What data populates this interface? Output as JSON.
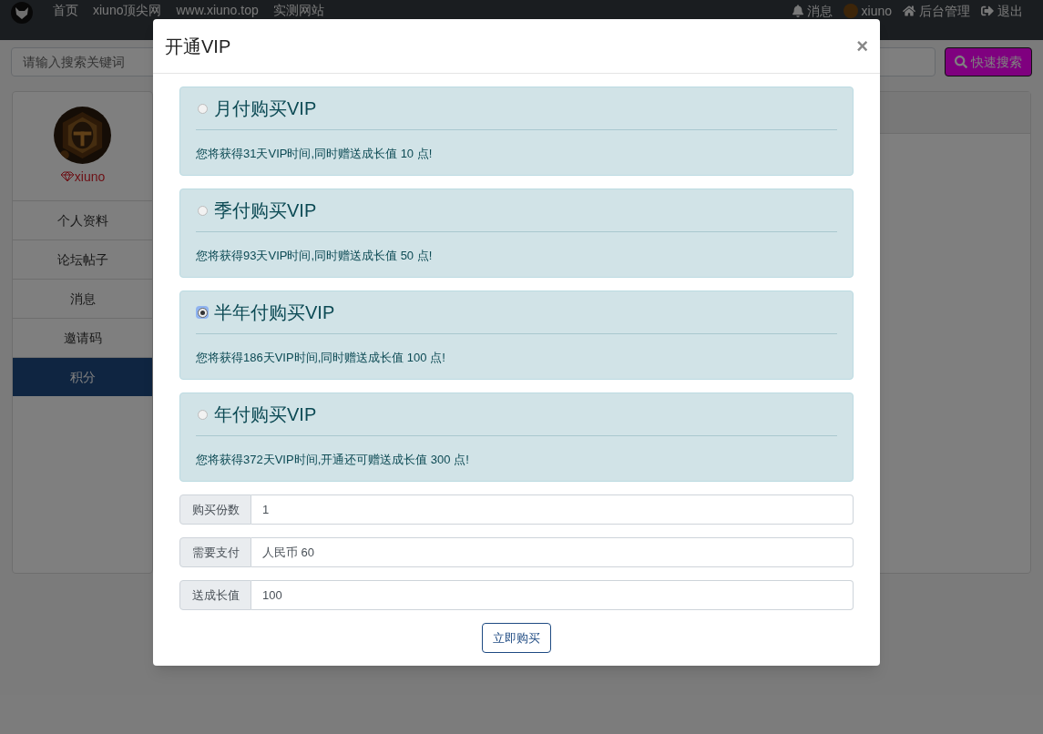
{
  "navbar": {
    "links": [
      "首页",
      "xiuno顶尖网",
      "www.xiuno.top",
      "实测网站"
    ],
    "right": [
      {
        "kind": "bell",
        "label": "消息"
      },
      {
        "kind": "avatar",
        "label": "xiuno"
      },
      {
        "kind": "home",
        "label": "后台管理"
      },
      {
        "kind": "logout",
        "label": "退出"
      }
    ]
  },
  "search": {
    "placeholder": "请输入搜索关键词",
    "button": "快速搜索"
  },
  "sidebar": {
    "username": "xiuno",
    "items": [
      {
        "label": "个人资料",
        "selected": false
      },
      {
        "label": "论坛帖子",
        "selected": false
      },
      {
        "label": "消息",
        "selected": false
      },
      {
        "label": "邀请码",
        "selected": false
      },
      {
        "label": "积分",
        "selected": true
      }
    ]
  },
  "modal": {
    "title": "开通VIP",
    "close": "×",
    "plans": [
      {
        "title": "月付购买VIP",
        "selected": false,
        "description": "您将获得31天VIP时间,同时赠送成长值 10 点!"
      },
      {
        "title": "季付购买VIP",
        "selected": false,
        "description": "您将获得93天VIP时间,同时赠送成长值 50 点!"
      },
      {
        "title": "半年付购买VIP",
        "selected": true,
        "description": "您将获得186天VIP时间,同时赠送成长值 100 点!"
      },
      {
        "title": "年付购买VIP",
        "selected": false,
        "description": "您将获得372天VIP时间,开通还可赠送成长值 300 点!"
      }
    ],
    "fields": [
      {
        "label": "购买份数",
        "value": "1"
      },
      {
        "label": "需要支付",
        "value": "人民币 60"
      },
      {
        "label": "送成长值",
        "value": "100"
      }
    ],
    "submit": "立即购买"
  }
}
